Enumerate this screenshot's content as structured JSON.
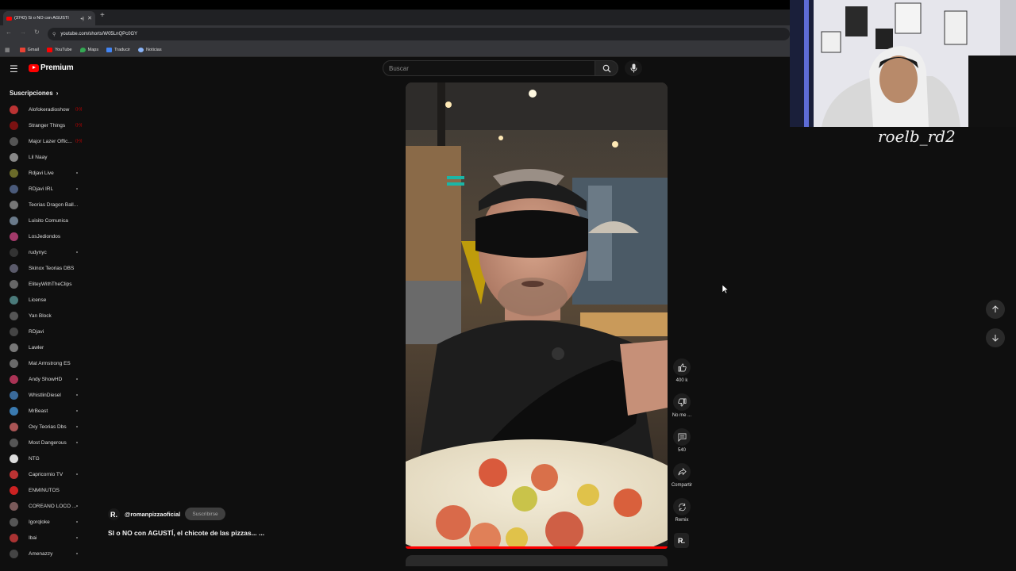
{
  "browser": {
    "tab_title": "(3742) Si o NO con AGUSTÍ",
    "url": "youtube.com/shorts/W05LnQPc0GY",
    "bookmarks": [
      {
        "label": "Gmail",
        "color": "#ea4335"
      },
      {
        "label": "YouTube",
        "color": "#ff0000"
      },
      {
        "label": "Maps",
        "color": "#34a853"
      },
      {
        "label": "Traducir",
        "color": "#4285f4"
      },
      {
        "label": "Noticias",
        "color": "#8ab4f8"
      }
    ]
  },
  "header": {
    "logo_text": "Premium",
    "search_placeholder": "Buscar"
  },
  "sidebar": {
    "title": "Suscripciones",
    "items": [
      {
        "name": "Alofokeradioshow",
        "avatar": "#b33",
        "status": "live"
      },
      {
        "name": "Stranger Things",
        "avatar": "#7a1111",
        "status": "live"
      },
      {
        "name": "Major Lazer Offic...",
        "avatar": "#555",
        "status": "live"
      },
      {
        "name": "Lil Naay",
        "avatar": "#888",
        "status": ""
      },
      {
        "name": "Rdjavi Live",
        "avatar": "#6b6b2a",
        "status": "dot"
      },
      {
        "name": "RDjavi IRL",
        "avatar": "#4a5a7a",
        "status": "dot"
      },
      {
        "name": "Teorias Dragon Ball...",
        "avatar": "#777",
        "status": ""
      },
      {
        "name": "Luisito Comunica",
        "avatar": "#6a7a8a",
        "status": ""
      },
      {
        "name": "LosJediondos",
        "avatar": "#a33a6a",
        "status": ""
      },
      {
        "name": "rudynyc",
        "avatar": "#333",
        "status": "dot"
      },
      {
        "name": "Skinox Teorias DBS",
        "avatar": "#5a5a6a",
        "status": ""
      },
      {
        "name": "EliteyWithTheClips",
        "avatar": "#666",
        "status": ""
      },
      {
        "name": "License",
        "avatar": "#4a7a7a",
        "status": ""
      },
      {
        "name": "Yan Block",
        "avatar": "#555",
        "status": ""
      },
      {
        "name": "RDjavi",
        "avatar": "#444",
        "status": ""
      },
      {
        "name": "Lawler",
        "avatar": "#777",
        "status": ""
      },
      {
        "name": "Mat Armstrong ES",
        "avatar": "#6a6a6a",
        "status": ""
      },
      {
        "name": "Andy ShowHD",
        "avatar": "#a35",
        "status": "dot"
      },
      {
        "name": "WhistlinDiesel",
        "avatar": "#3a6a9a",
        "status": "dot"
      },
      {
        "name": "MrBeast",
        "avatar": "#3a7ab0",
        "status": "dot"
      },
      {
        "name": "Oxy Teorias Dbs",
        "avatar": "#a55",
        "status": "dot"
      },
      {
        "name": "Most Dangerous",
        "avatar": "#555",
        "status": "dot"
      },
      {
        "name": "NTG",
        "avatar": "#ddd",
        "status": ""
      },
      {
        "name": "Capricornio TV",
        "avatar": "#b33",
        "status": "dot"
      },
      {
        "name": "ENMINUTOS",
        "avatar": "#c22",
        "status": ""
      },
      {
        "name": "COREANO LOCO ...",
        "avatar": "#7a5a5a",
        "status": "dot"
      },
      {
        "name": "Igorqloke",
        "avatar": "#555",
        "status": "dot"
      },
      {
        "name": "Ibai",
        "avatar": "#a33",
        "status": "dot"
      },
      {
        "name": "Amenazzy",
        "avatar": "#444",
        "status": "dot"
      }
    ]
  },
  "short": {
    "channel_initial": "R.",
    "channel_handle": "@romanpizzaoficial",
    "subscribe_label": "Suscribirse",
    "title": "SI o NO con AGUSTÍ, el chicote de las pizzas... ...",
    "like_count": "400 k",
    "dislike_label": "No me ...",
    "comment_count": "540",
    "share_label": "Compartir",
    "remix_label": "Remix"
  },
  "webcam": {
    "label": "roelb_rd2"
  }
}
